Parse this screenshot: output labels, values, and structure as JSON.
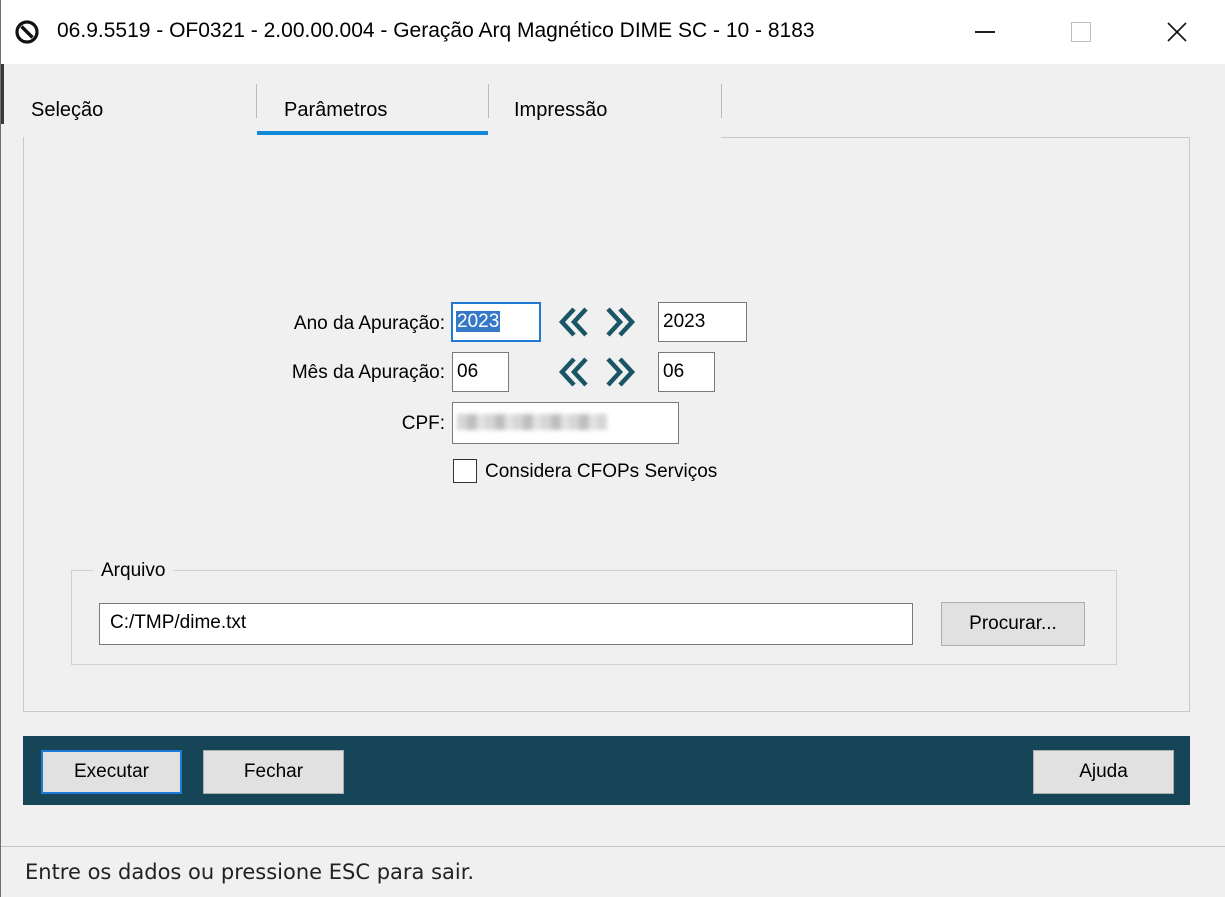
{
  "window": {
    "title": "06.9.5519 - OF0321 - 2.00.00.004 - Geração Arq Magnético DIME SC - 10 - 8183",
    "close_glyph": "✕"
  },
  "tabs": [
    {
      "label": "Seleção"
    },
    {
      "label": "Parâmetros",
      "active": true
    },
    {
      "label": "Impressão"
    }
  ],
  "form": {
    "ano_label": "Ano da Apuração:",
    "ano_from": "2023",
    "ano_to": "2023",
    "mes_label": "Mês da Apuração:",
    "mes_from": "06",
    "mes_to": "06",
    "cpf_label": "CPF:",
    "cpf_value": "",
    "considera_label": "Considera CFOPs Serviços",
    "considera_checked": false
  },
  "arquivo": {
    "legend": "Arquivo",
    "path": "C:/TMP/dime.txt",
    "procurar_label": "Procurar..."
  },
  "buttons": {
    "executar": "Executar",
    "fechar": "Fechar",
    "ajuda": "Ajuda"
  },
  "status": "Entre os dados ou pressione ESC para sair.",
  "colors": {
    "accent": "#1188d9",
    "bottom_bar": "#154556",
    "arrow": "#1a5566"
  }
}
